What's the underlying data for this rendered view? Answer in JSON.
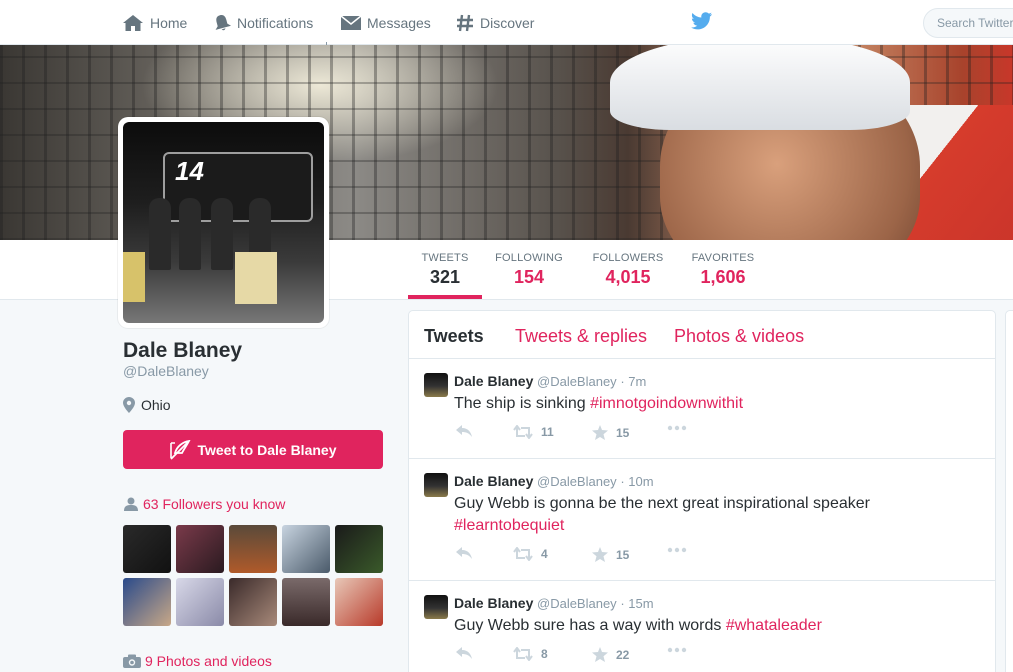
{
  "nav": {
    "home": "Home",
    "notifications": "Notifications",
    "messages": "Messages",
    "discover": "Discover",
    "search_placeholder": "Search Twitter"
  },
  "stats": [
    {
      "label": "TWEETS",
      "value": "321"
    },
    {
      "label": "FOLLOWING",
      "value": "154"
    },
    {
      "label": "FOLLOWERS",
      "value": "4,015"
    },
    {
      "label": "FAVORITES",
      "value": "1,606"
    }
  ],
  "profile": {
    "name": "Dale Blaney",
    "handle": "@DaleBlaney",
    "location": "Ohio",
    "tweet_to_button": "Tweet to Dale Blaney",
    "followers_you_know": "63 Followers you know",
    "photos_videos": "9 Photos and videos",
    "avatar_car_number": "14"
  },
  "tabs": [
    "Tweets",
    "Tweets & replies",
    "Photos & videos"
  ],
  "tweets": [
    {
      "name": "Dale Blaney",
      "handle": "@DaleBlaney",
      "time": "· 7m",
      "text": "The ship is sinking ",
      "hashtag": "#imnotgoindownwithit",
      "retweets": "11",
      "favorites": "15"
    },
    {
      "name": "Dale Blaney",
      "handle": "@DaleBlaney",
      "time": "· 10m",
      "text": "Guy Webb is gonna be the next great inspirational speaker",
      "hashtag": "#learntobequiet",
      "retweets": "4",
      "favorites": "15"
    },
    {
      "name": "Dale Blaney",
      "handle": "@DaleBlaney",
      "time": "· 15m",
      "text": "Guy Webb sure has a way with words ",
      "hashtag": "#whataleader",
      "retweets": "8",
      "favorites": "22"
    }
  ],
  "colors": {
    "accent": "#e0245e",
    "twitter_blue": "#55acee",
    "text": "#292f33",
    "muted": "#8899a6"
  },
  "icons": {
    "home": "home-icon",
    "notifications": "bell-icon",
    "messages": "envelope-icon",
    "discover": "hashtag-icon",
    "brand": "twitter-bird-icon",
    "location": "map-pin-icon",
    "tweet": "feather-icon",
    "followers": "person-icon",
    "photos": "camera-icon",
    "reply": "reply-icon",
    "retweet": "retweet-icon",
    "favorite": "star-icon",
    "more": "more-dots-icon"
  }
}
